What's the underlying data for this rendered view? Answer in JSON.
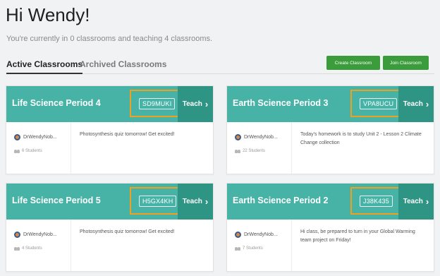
{
  "header": {
    "greeting": "Hi Wendy!",
    "subtitle": "You're currently in 0 classrooms and teaching 4 classrooms."
  },
  "tabs": {
    "active": "Active Classrooms",
    "archived": "Archived Classrooms"
  },
  "actions": {
    "create": "Create Classroom",
    "join": "Join Classroom"
  },
  "colors": {
    "header_bg": "#47b3a6",
    "teach_bg": "#2e9484",
    "highlight": "#f0a01e",
    "button_green": "#3a9c3a"
  },
  "classrooms": [
    {
      "title": "Life Science Period 4",
      "code": "SD9MUKI",
      "teach_label": "Teach",
      "teacher": "DrWendyNob...",
      "students": "6 Students",
      "message": "Photosynthesis quiz tomorrow! Get excited!"
    },
    {
      "title": "Earth Science Period 3",
      "code": "VPA8UCU",
      "teach_label": "Teach",
      "teacher": "DrWendyNob...",
      "students": "22 Students",
      "message": "Today's homework is to study Unit 2 - Lesson 2 Climate Change collection"
    },
    {
      "title": "Life Science Period 5",
      "code": "H5GX4KH",
      "teach_label": "Teach",
      "teacher": "DrWendyNob...",
      "students": "4 Students",
      "message": "Photosynthesis quiz tomorrow! Get excited!"
    },
    {
      "title": "Earth Science Period 2",
      "code": "J38K435",
      "teach_label": "Teach",
      "teacher": "DrWendyNob...",
      "students": "7 Students",
      "message": "Hi class, be prepared to turn in your Global Warming team project on Friday!"
    }
  ]
}
